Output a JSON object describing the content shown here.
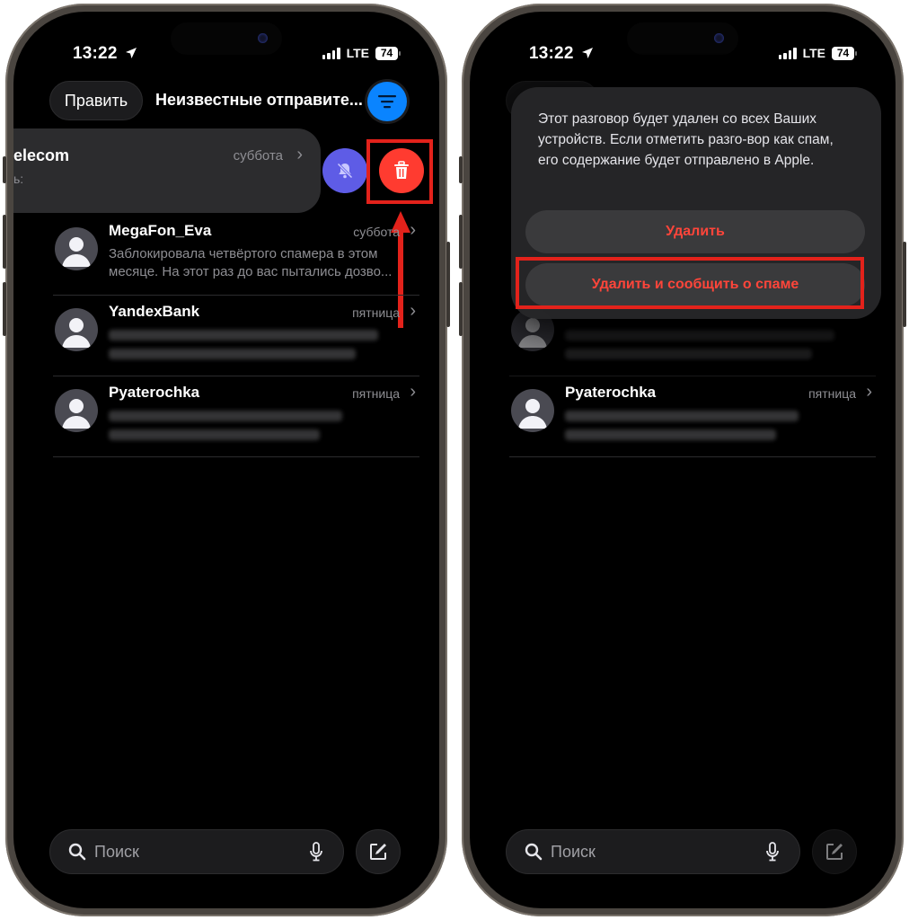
{
  "status": {
    "time": "13:22",
    "network": "LTE",
    "battery": "74"
  },
  "nav": {
    "edit_label": "Править",
    "title": "Неизвестные отправите..."
  },
  "swiped": {
    "name": "elecom",
    "date": "суббота",
    "snippet": "ь:"
  },
  "conversations": [
    {
      "name": "MegaFon_Eva",
      "date": "суббота",
      "snippet_line1": "Заблокировала четвёртого спамера в этом",
      "snippet_line2": "месяце. На этот раз до вас пытались дозво..."
    },
    {
      "name": "YandexBank",
      "date": "пятница"
    },
    {
      "name": "Pyaterochka",
      "date": "пятница"
    }
  ],
  "search": {
    "placeholder": "Поиск"
  },
  "dialog": {
    "message": "Этот разговор будет удален со всех Ваших устройств. Если отметить разго-вор как спам, его содержание будет отправлено в Apple.",
    "delete_label": "Удалить",
    "delete_report_label": "Удалить и сообщить о спаме"
  },
  "colors": {
    "accent": "#0a84ff",
    "destructive": "#ff3b30",
    "mute": "#5e5ce6",
    "highlight": "#e3221b"
  }
}
